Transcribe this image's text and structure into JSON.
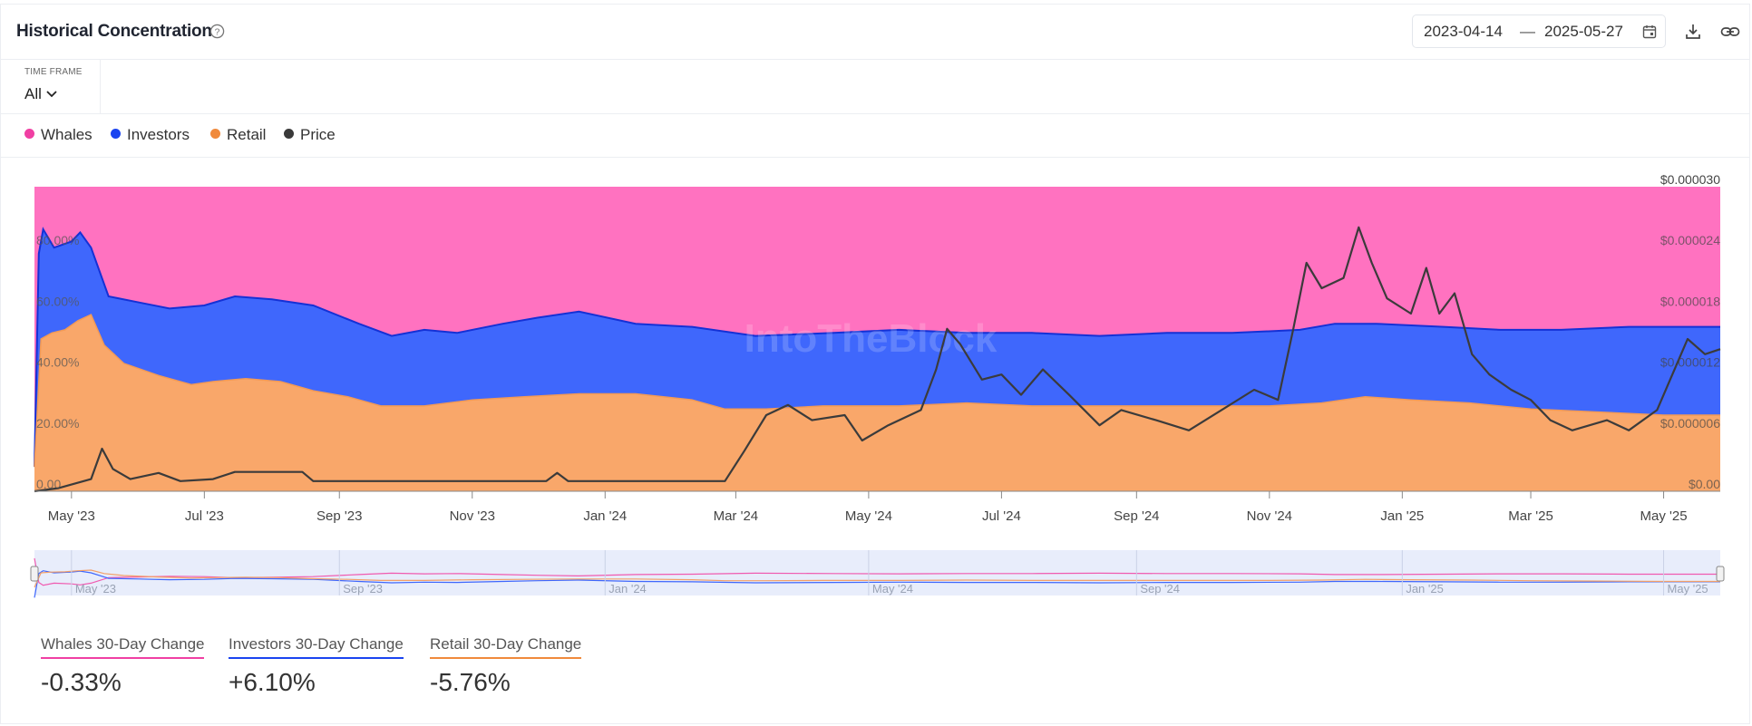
{
  "header": {
    "title": "Historical Concentration",
    "date_start": "2023-04-14",
    "date_separator": "—",
    "date_end": "2025-05-27"
  },
  "timeframe": {
    "label": "TIME FRAME",
    "value": "All"
  },
  "legend": [
    {
      "name": "Whales",
      "color": "#f03fa3"
    },
    {
      "name": "Investors",
      "color": "#1a44f0"
    },
    {
      "name": "Retail",
      "color": "#f08a3c"
    },
    {
      "name": "Price",
      "color": "#3a3a3a"
    }
  ],
  "watermark": "IntoTheBlock",
  "changes": [
    {
      "label": "Whales 30-Day Change",
      "value": "-0.33%",
      "color": "#f03fa3"
    },
    {
      "label": "Investors 30-Day Change",
      "value": "+6.10%",
      "color": "#1a44f0"
    },
    {
      "label": "Retail 30-Day Change",
      "value": "-5.76%",
      "color": "#f08a3c"
    }
  ],
  "chart_data": {
    "type": "area",
    "stacked": true,
    "x_range": [
      "2023-04-14",
      "2025-05-27"
    ],
    "y_left": {
      "range": [
        0,
        100
      ],
      "unit": "%",
      "ticks": [
        "0.00",
        "20.00%",
        "40.00%",
        "60.00%",
        "80.00%"
      ]
    },
    "y_right": {
      "range": [
        0,
        3e-05
      ],
      "ticks": [
        "$0.00",
        "$0.000006",
        "$0.000012",
        "$0.000018",
        "$0.000024",
        "$0.000030"
      ]
    },
    "x_ticks": [
      "May '23",
      "Jul '23",
      "Sep '23",
      "Nov '23",
      "Jan '24",
      "Mar '24",
      "May '24",
      "Jul '24",
      "Sep '24",
      "Nov '24",
      "Jan '25",
      "Mar '25",
      "May '25"
    ],
    "navigator_ticks": [
      "May '23",
      "Sep '23",
      "Jan '24",
      "May '24",
      "Sep '24",
      "Jan '25",
      "May '25"
    ],
    "series": [
      {
        "name": "Retail",
        "kind": "area",
        "axis": "left",
        "color": "#f9a76a",
        "points": [
          [
            "2023-04-14",
            8
          ],
          [
            "2023-04-17",
            50
          ],
          [
            "2023-04-22",
            52
          ],
          [
            "2023-04-28",
            53
          ],
          [
            "2023-05-04",
            56
          ],
          [
            "2023-05-10",
            58
          ],
          [
            "2023-05-16",
            48
          ],
          [
            "2023-05-25",
            42
          ],
          [
            "2023-06-10",
            38
          ],
          [
            "2023-06-25",
            35
          ],
          [
            "2023-07-05",
            36
          ],
          [
            "2023-07-20",
            37
          ],
          [
            "2023-08-05",
            36
          ],
          [
            "2023-08-20",
            33
          ],
          [
            "2023-09-05",
            31
          ],
          [
            "2023-09-20",
            28
          ],
          [
            "2023-10-10",
            28
          ],
          [
            "2023-11-01",
            30
          ],
          [
            "2023-11-25",
            31
          ],
          [
            "2023-12-20",
            32
          ],
          [
            "2024-01-15",
            32
          ],
          [
            "2024-02-10",
            30
          ],
          [
            "2024-02-25",
            27
          ],
          [
            "2024-03-15",
            27
          ],
          [
            "2024-04-10",
            28
          ],
          [
            "2024-05-15",
            28
          ],
          [
            "2024-06-15",
            29
          ],
          [
            "2024-07-15",
            28
          ],
          [
            "2024-09-01",
            28
          ],
          [
            "2024-10-01",
            28
          ],
          [
            "2024-11-01",
            28
          ],
          [
            "2024-11-25",
            29
          ],
          [
            "2024-12-15",
            31
          ],
          [
            "2025-01-05",
            30
          ],
          [
            "2025-02-01",
            29
          ],
          [
            "2025-03-01",
            27
          ],
          [
            "2025-04-01",
            26
          ],
          [
            "2025-05-01",
            25
          ],
          [
            "2025-05-27",
            25
          ]
        ]
      },
      {
        "name": "Investors",
        "kind": "area",
        "axis": "left",
        "color": "#3f67fc",
        "points": [
          [
            "2023-04-14",
            8
          ],
          [
            "2023-04-16",
            78
          ],
          [
            "2023-04-18",
            86
          ],
          [
            "2023-04-23",
            80
          ],
          [
            "2023-05-01",
            82
          ],
          [
            "2023-05-05",
            85
          ],
          [
            "2023-05-10",
            80
          ],
          [
            "2023-05-18",
            64
          ],
          [
            "2023-06-01",
            62
          ],
          [
            "2023-06-15",
            60
          ],
          [
            "2023-07-01",
            61
          ],
          [
            "2023-07-15",
            64
          ],
          [
            "2023-08-01",
            63
          ],
          [
            "2023-08-20",
            61
          ],
          [
            "2023-09-10",
            55
          ],
          [
            "2023-09-25",
            51
          ],
          [
            "2023-10-10",
            53
          ],
          [
            "2023-10-25",
            52
          ],
          [
            "2023-11-15",
            55
          ],
          [
            "2023-12-01",
            57
          ],
          [
            "2023-12-20",
            59
          ],
          [
            "2024-01-15",
            55
          ],
          [
            "2024-02-10",
            54
          ],
          [
            "2024-03-10",
            51
          ],
          [
            "2024-04-15",
            52
          ],
          [
            "2024-05-15",
            53
          ],
          [
            "2024-06-15",
            52
          ],
          [
            "2024-07-15",
            52
          ],
          [
            "2024-08-15",
            51
          ],
          [
            "2024-09-15",
            52
          ],
          [
            "2024-10-15",
            52
          ],
          [
            "2024-11-15",
            53
          ],
          [
            "2024-12-01",
            55
          ],
          [
            "2024-12-20",
            55
          ],
          [
            "2025-01-20",
            54
          ],
          [
            "2025-02-15",
            53
          ],
          [
            "2025-03-15",
            53
          ],
          [
            "2025-04-15",
            54
          ],
          [
            "2025-05-27",
            54
          ]
        ]
      },
      {
        "name": "Whales",
        "kind": "area",
        "axis": "left",
        "color": "#ff72c0",
        "points": [
          [
            "2023-04-14",
            100
          ],
          [
            "2025-05-27",
            100
          ]
        ]
      },
      {
        "name": "Price",
        "kind": "line",
        "axis": "right",
        "color": "#3b3b3b",
        "points": [
          [
            "2023-04-14",
            0
          ],
          [
            "2023-04-25",
            3e-07
          ],
          [
            "2023-05-10",
            1.2e-06
          ],
          [
            "2023-05-15",
            4.2e-06
          ],
          [
            "2023-05-20",
            2.2e-06
          ],
          [
            "2023-05-28",
            1.2e-06
          ],
          [
            "2023-06-10",
            1.8e-06
          ],
          [
            "2023-06-20",
            1e-06
          ],
          [
            "2023-07-05",
            1.2e-06
          ],
          [
            "2023-07-15",
            1.9e-06
          ],
          [
            "2023-08-15",
            1.9e-06
          ],
          [
            "2023-08-20",
            1e-06
          ],
          [
            "2023-10-15",
            1e-06
          ],
          [
            "2023-12-05",
            1e-06
          ],
          [
            "2023-12-10",
            1.8e-06
          ],
          [
            "2023-12-15",
            1e-06
          ],
          [
            "2024-02-25",
            1e-06
          ],
          [
            "2024-03-05",
            4e-06
          ],
          [
            "2024-03-15",
            7.5e-06
          ],
          [
            "2024-03-25",
            8.5e-06
          ],
          [
            "2024-04-05",
            7e-06
          ],
          [
            "2024-04-20",
            7.5e-06
          ],
          [
            "2024-04-28",
            5e-06
          ],
          [
            "2024-05-10",
            6.5e-06
          ],
          [
            "2024-05-25",
            8e-06
          ],
          [
            "2024-06-01",
            1.2e-05
          ],
          [
            "2024-06-06",
            1.6e-05
          ],
          [
            "2024-06-12",
            1.45e-05
          ],
          [
            "2024-06-22",
            1.1e-05
          ],
          [
            "2024-07-01",
            1.15e-05
          ],
          [
            "2024-07-10",
            9.5e-06
          ],
          [
            "2024-07-20",
            1.2e-05
          ],
          [
            "2024-08-01",
            9.5e-06
          ],
          [
            "2024-08-15",
            6.5e-06
          ],
          [
            "2024-08-25",
            8e-06
          ],
          [
            "2024-09-10",
            7e-06
          ],
          [
            "2024-09-25",
            6e-06
          ],
          [
            "2024-10-10",
            8e-06
          ],
          [
            "2024-10-25",
            1e-05
          ],
          [
            "2024-11-05",
            9e-06
          ],
          [
            "2024-11-12",
            1.6e-05
          ],
          [
            "2024-11-18",
            2.25e-05
          ],
          [
            "2024-11-25",
            2e-05
          ],
          [
            "2024-12-05",
            2.1e-05
          ],
          [
            "2024-12-12",
            2.6e-05
          ],
          [
            "2024-12-18",
            2.25e-05
          ],
          [
            "2024-12-25",
            1.9e-05
          ],
          [
            "2025-01-05",
            1.75e-05
          ],
          [
            "2025-01-12",
            2.2e-05
          ],
          [
            "2025-01-18",
            1.75e-05
          ],
          [
            "2025-01-25",
            1.95e-05
          ],
          [
            "2025-02-02",
            1.35e-05
          ],
          [
            "2025-02-10",
            1.15e-05
          ],
          [
            "2025-02-20",
            1e-05
          ],
          [
            "2025-03-01",
            9e-06
          ],
          [
            "2025-03-10",
            7e-06
          ],
          [
            "2025-03-20",
            6e-06
          ],
          [
            "2025-04-05",
            7e-06
          ],
          [
            "2025-04-15",
            6e-06
          ],
          [
            "2025-04-28",
            8e-06
          ],
          [
            "2025-05-06",
            1.2e-05
          ],
          [
            "2025-05-12",
            1.5e-05
          ],
          [
            "2025-05-20",
            1.35e-05
          ],
          [
            "2025-05-27",
            1.4e-05
          ]
        ]
      }
    ]
  }
}
